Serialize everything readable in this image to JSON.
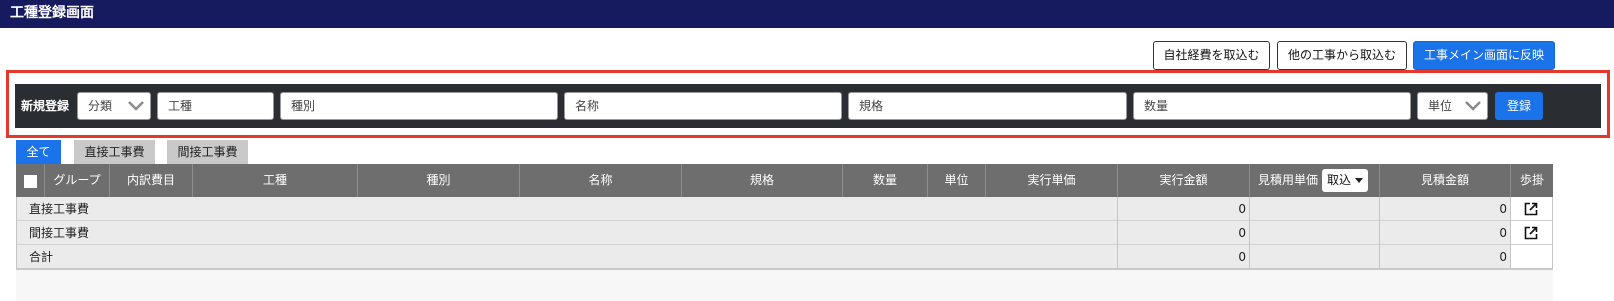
{
  "window": {
    "title": "工種登録画面"
  },
  "toolbar": {
    "import_own_expenses": "自社経費を取込む",
    "import_other_work": "他の工事から取込む",
    "reflect_main": "工事メイン画面に反映"
  },
  "form": {
    "label": "新規登録",
    "category_select": "分類",
    "work_type_placeholder": "工種",
    "kind_placeholder": "種別",
    "name_placeholder": "名称",
    "spec_placeholder": "規格",
    "quantity_placeholder": "数量",
    "unit_select": "単位",
    "register_label": "登録"
  },
  "tabs": [
    {
      "label": "全て",
      "active": true
    },
    {
      "label": "直接工事費",
      "active": false
    },
    {
      "label": "間接工事費",
      "active": false
    }
  ],
  "table": {
    "headers": {
      "group": "グループ",
      "breakdown": "内訳費目",
      "work_type": "工種",
      "kind": "種別",
      "name": "名称",
      "spec": "規格",
      "quantity": "数量",
      "unit": "単位",
      "exec_unit_price": "実行単価",
      "exec_amount": "実行金額",
      "estimate_unit_price": "見積用単価",
      "estimate_import": "取込",
      "estimate_amount": "見積金額",
      "rate": "歩掛"
    },
    "rows": [
      {
        "label": "直接工事費",
        "exec_amount": "0",
        "estimate_amount": "0",
        "has_link": true
      },
      {
        "label": "間接工事費",
        "exec_amount": "0",
        "estimate_amount": "0",
        "has_link": true
      },
      {
        "label": "合計",
        "exec_amount": "0",
        "estimate_amount": "0",
        "has_link": false
      }
    ]
  },
  "colors": {
    "titlebar": "#151b5e",
    "accent": "#1a73e8",
    "highlight": "#e5372b",
    "table_header": "#6e6e6e"
  },
  "icons": {
    "dropdown": "chevron-down-icon",
    "open_external": "external-link-icon"
  }
}
